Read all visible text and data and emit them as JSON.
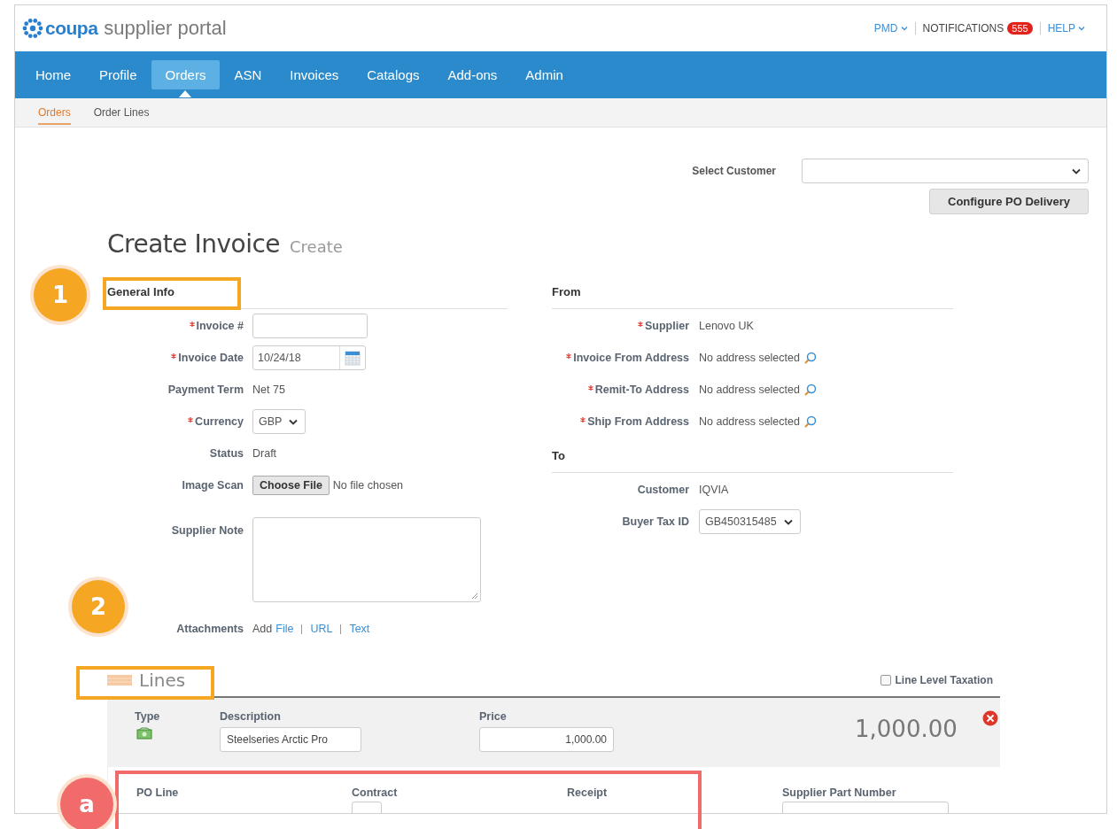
{
  "header": {
    "brand": "coupa",
    "product": "supplier portal",
    "user_menu": "PMD",
    "notifications": {
      "label": "NOTIFICATIONS",
      "count": "555"
    },
    "help_menu": "HELP"
  },
  "nav": [
    {
      "label": "Home",
      "selected": false
    },
    {
      "label": "Profile",
      "selected": false
    },
    {
      "label": "Orders",
      "selected": true
    },
    {
      "label": "ASN",
      "selected": false
    },
    {
      "label": "Invoices",
      "selected": false
    },
    {
      "label": "Catalogs",
      "selected": false
    },
    {
      "label": "Add-ons",
      "selected": false
    },
    {
      "label": "Admin",
      "selected": false
    }
  ],
  "subnav": [
    {
      "label": "Orders",
      "selected": true
    },
    {
      "label": "Order Lines",
      "selected": false
    }
  ],
  "customer_select": {
    "label": "Select Customer"
  },
  "configure_button": "Configure PO Delivery",
  "page_title": {
    "title": "Create Invoice",
    "subtitle": "Create"
  },
  "general_info": {
    "heading": "General Info",
    "fields": [
      {
        "label": "Invoice #",
        "required": true,
        "kind": "input"
      },
      {
        "label": "Invoice Date",
        "required": true,
        "kind": "date",
        "value": "10/24/18"
      },
      {
        "label": "Payment Term",
        "required": false,
        "kind": "text",
        "value": "Net 75"
      },
      {
        "label": "Currency",
        "required": true,
        "kind": "select",
        "value": "GBP"
      },
      {
        "label": "Status",
        "required": false,
        "kind": "text",
        "value": "Draft"
      },
      {
        "label": "Image Scan",
        "required": false,
        "kind": "file",
        "button": "Choose File",
        "value": "No file chosen"
      },
      {
        "label": "Supplier Note",
        "required": false,
        "kind": "textarea"
      },
      {
        "label": "Attachments",
        "required": false,
        "kind": "links",
        "value": "Add",
        "links": [
          "File",
          "URL",
          "Text"
        ]
      }
    ]
  },
  "from": {
    "heading": "From",
    "fields": [
      {
        "label": "Supplier",
        "required": true,
        "kind": "text",
        "value": "Lenovo UK"
      },
      {
        "label": "Invoice From Address",
        "required": true,
        "kind": "address",
        "value": "No address selected"
      },
      {
        "label": "Remit-To Address",
        "required": true,
        "kind": "address",
        "value": "No address selected"
      },
      {
        "label": "Ship From Address",
        "required": true,
        "kind": "address",
        "value": "No address selected"
      }
    ]
  },
  "to": {
    "heading": "To",
    "fields": [
      {
        "label": "Customer",
        "required": false,
        "kind": "text",
        "value": "IQVIA"
      },
      {
        "label": "Buyer Tax ID",
        "required": false,
        "kind": "select",
        "value": "GB450315485"
      }
    ]
  },
  "lines": {
    "heading": "Lines",
    "line_level_taxation": {
      "label": "Line Level Taxation",
      "checked": false
    },
    "line": {
      "type_label": "Type",
      "description_label": "Description",
      "description": "Steelseries Arctic Pro",
      "price_label": "Price",
      "price": "1,000.00",
      "total": "1,000.00"
    },
    "detail_columns": [
      "PO Line",
      "Contract",
      "Receipt",
      "Supplier Part Number"
    ]
  },
  "callouts": [
    {
      "label": "1",
      "color": "#f5a623"
    },
    {
      "label": "2",
      "color": "#f5a623"
    },
    {
      "label": "a",
      "color": "#f26b6b"
    }
  ]
}
